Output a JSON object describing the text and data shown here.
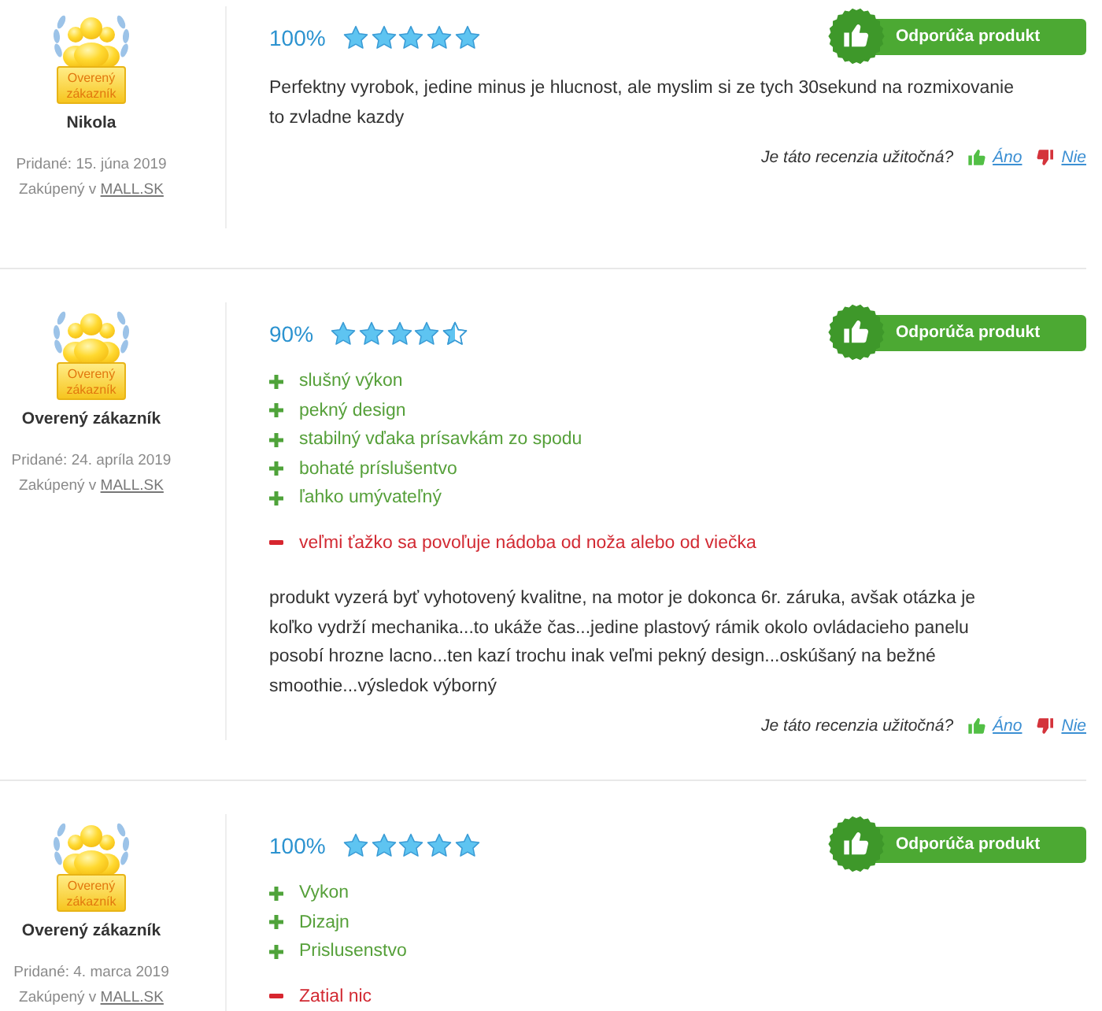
{
  "reviews": [
    {
      "author": {
        "badge_label": "Overený zákazník",
        "name": "Nikola",
        "added": "Pridané: 15. júna 2019",
        "purchased": {
          "text": "Zakúpený v",
          "store": "MALL.SK"
        }
      },
      "rating": {
        "percent": "100%",
        "stars": 5
      },
      "recommended": true,
      "recommend_label": "Odporúča produkt",
      "text": "Perfektny vyrobok, jedine minus je hlucnost, ale myslim si ze tych 30sekund na rozmixovanie to zvladne kazdy",
      "helpful": {
        "question": "Je táto recenzia užitočná?",
        "yes": "Áno",
        "no": "Nie"
      }
    },
    {
      "author": {
        "badge_label": "Overený zákazník",
        "name": "Overený zákazník",
        "added": "Pridané: 24. apríla 2019",
        "purchased": {
          "text": "Zakúpený v",
          "store": "MALL.SK"
        }
      },
      "rating": {
        "percent": "90%",
        "stars": 4.5
      },
      "recommended": true,
      "recommend_label": "Odporúča produkt",
      "pros": [
        "slušný výkon",
        "pekný design",
        "stabilný vďaka prísavkám zo spodu",
        "bohaté príslušentvo",
        "ľahko umývateľný"
      ],
      "cons": [
        "veľmi ťažko sa povoľuje nádoba od noža alebo od viečka"
      ],
      "text": "produkt vyzerá byť vyhotovený kvalitne, na motor je dokonca 6r. záruka, avšak otázka je koľko vydrží mechanika...to ukáže čas...jedine plastový rámik okolo ovládacieho panelu posobí hrozne lacno...ten kazí trochu inak veľmi pekný design...oskúšaný na bežné smoothie...výsledok výborný",
      "helpful": {
        "question": "Je táto recenzia užitočná?",
        "yes": "Áno",
        "no": "Nie"
      }
    },
    {
      "author": {
        "badge_label": "Overený zákazník",
        "name": "Overený zákazník",
        "added": "Pridané: 4. marca 2019",
        "purchased": {
          "text": "Zakúpený v",
          "store": "MALL.SK"
        }
      },
      "rating": {
        "percent": "100%",
        "stars": 5
      },
      "recommended": true,
      "recommend_label": "Odporúča produkt",
      "pros": [
        "Vykon",
        "Dizajn",
        "Prislusenstvo"
      ],
      "cons": [
        "Zatial nic"
      ]
    }
  ]
}
